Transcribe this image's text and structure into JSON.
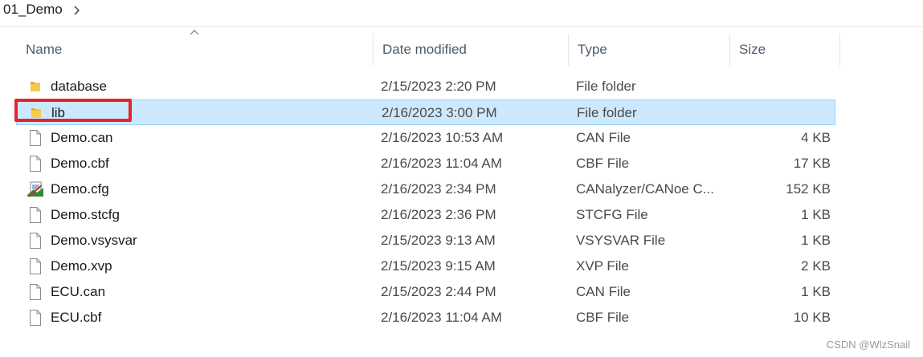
{
  "breadcrumb": {
    "current": "01_Demo",
    "chevron_icon": "chevron-right-icon"
  },
  "columns": {
    "name": "Name",
    "date": "Date modified",
    "type": "Type",
    "size": "Size"
  },
  "files": [
    {
      "name": "database",
      "date": "2/15/2023 2:20 PM",
      "type": "File folder",
      "size": "",
      "icon": "folder-icon",
      "selected": false
    },
    {
      "name": "lib",
      "date": "2/16/2023 3:00 PM",
      "type": "File folder",
      "size": "",
      "icon": "folder-icon",
      "selected": true
    },
    {
      "name": "Demo.can",
      "date": "2/16/2023 10:53 AM",
      "type": "CAN File",
      "size": "4 KB",
      "icon": "file-icon",
      "selected": false
    },
    {
      "name": "Demo.cbf",
      "date": "2/16/2023 11:04 AM",
      "type": "CBF File",
      "size": "17 KB",
      "icon": "file-icon",
      "selected": false
    },
    {
      "name": "Demo.cfg",
      "date": "2/16/2023 2:34 PM",
      "type": "CANalyzer/CANoe C...",
      "size": "152 KB",
      "icon": "canoe-config-icon",
      "selected": false
    },
    {
      "name": "Demo.stcfg",
      "date": "2/16/2023 2:36 PM",
      "type": "STCFG File",
      "size": "1 KB",
      "icon": "file-icon",
      "selected": false
    },
    {
      "name": "Demo.vsysvar",
      "date": "2/15/2023 9:13 AM",
      "type": "VSYSVAR File",
      "size": "1 KB",
      "icon": "file-icon",
      "selected": false
    },
    {
      "name": "Demo.xvp",
      "date": "2/15/2023 9:15 AM",
      "type": "XVP File",
      "size": "2 KB",
      "icon": "file-icon",
      "selected": false
    },
    {
      "name": "ECU.can",
      "date": "2/15/2023 2:44 PM",
      "type": "CAN File",
      "size": "1 KB",
      "icon": "file-icon",
      "selected": false
    },
    {
      "name": "ECU.cbf",
      "date": "2/16/2023 11:04 AM",
      "type": "CBF File",
      "size": "10 KB",
      "icon": "file-icon",
      "selected": false
    }
  ],
  "watermark": "CSDN @WlzSnail",
  "colors": {
    "selection": "#cce8ff",
    "selection_border": "#99d1ff",
    "highlight": "#e8212a",
    "folder": "#f0c24b"
  }
}
